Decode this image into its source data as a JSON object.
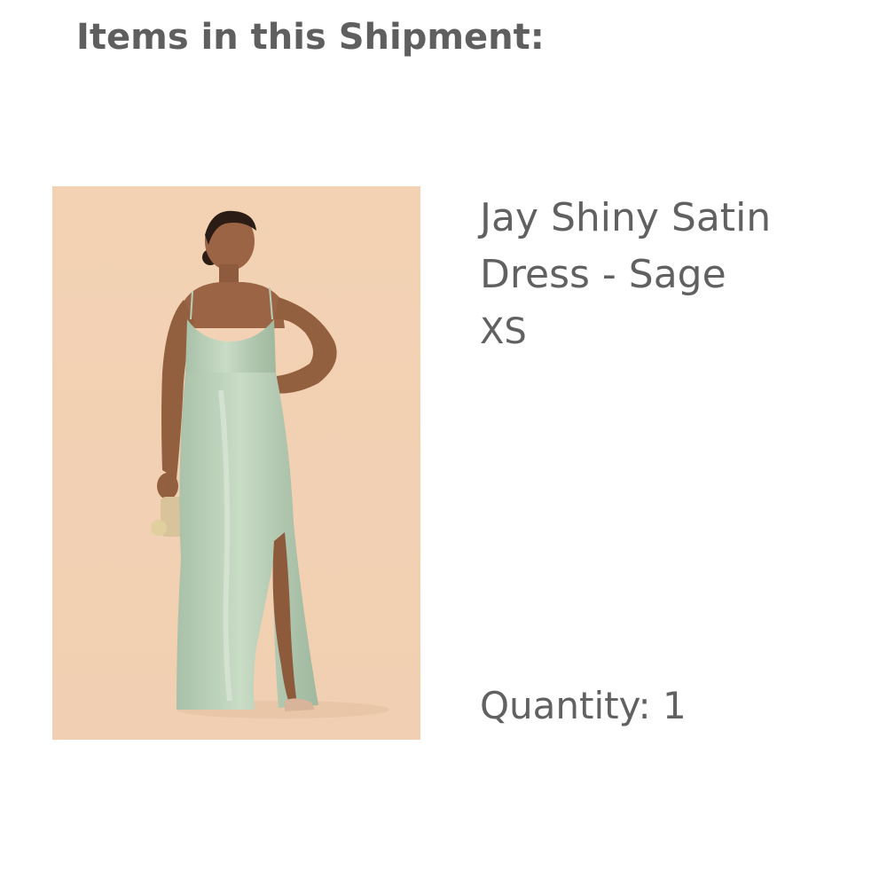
{
  "shipment": {
    "heading": "Items in this Shipment:",
    "items": [
      {
        "name": "Jay Shiny Satin Dress - Sage",
        "size": "XS",
        "quantity_label": "Quantity:",
        "quantity": "1",
        "quantity_text": "Quantity: 1",
        "image_icon": "product-photo",
        "colors": {
          "background": "#f4d3b6",
          "dress": "#b9cfb8",
          "skin": "#9a6445"
        }
      }
    ]
  }
}
